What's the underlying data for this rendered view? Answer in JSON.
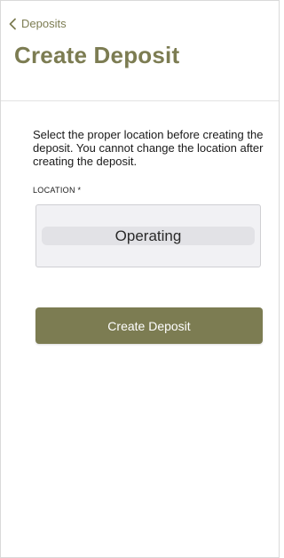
{
  "nav": {
    "back_label": "Deposits"
  },
  "page": {
    "title": "Create Deposit"
  },
  "form": {
    "instructions": "Select the proper location before creating the deposit. You cannot change the location after creating the deposit.",
    "location_label": "LOCATION *",
    "location_value": "Operating",
    "submit_label": "Create Deposit"
  },
  "colors": {
    "accent": "#7c7c52",
    "picker_bg": "#f1f1f4"
  },
  "icons": {
    "back": "chevron-left-icon"
  }
}
